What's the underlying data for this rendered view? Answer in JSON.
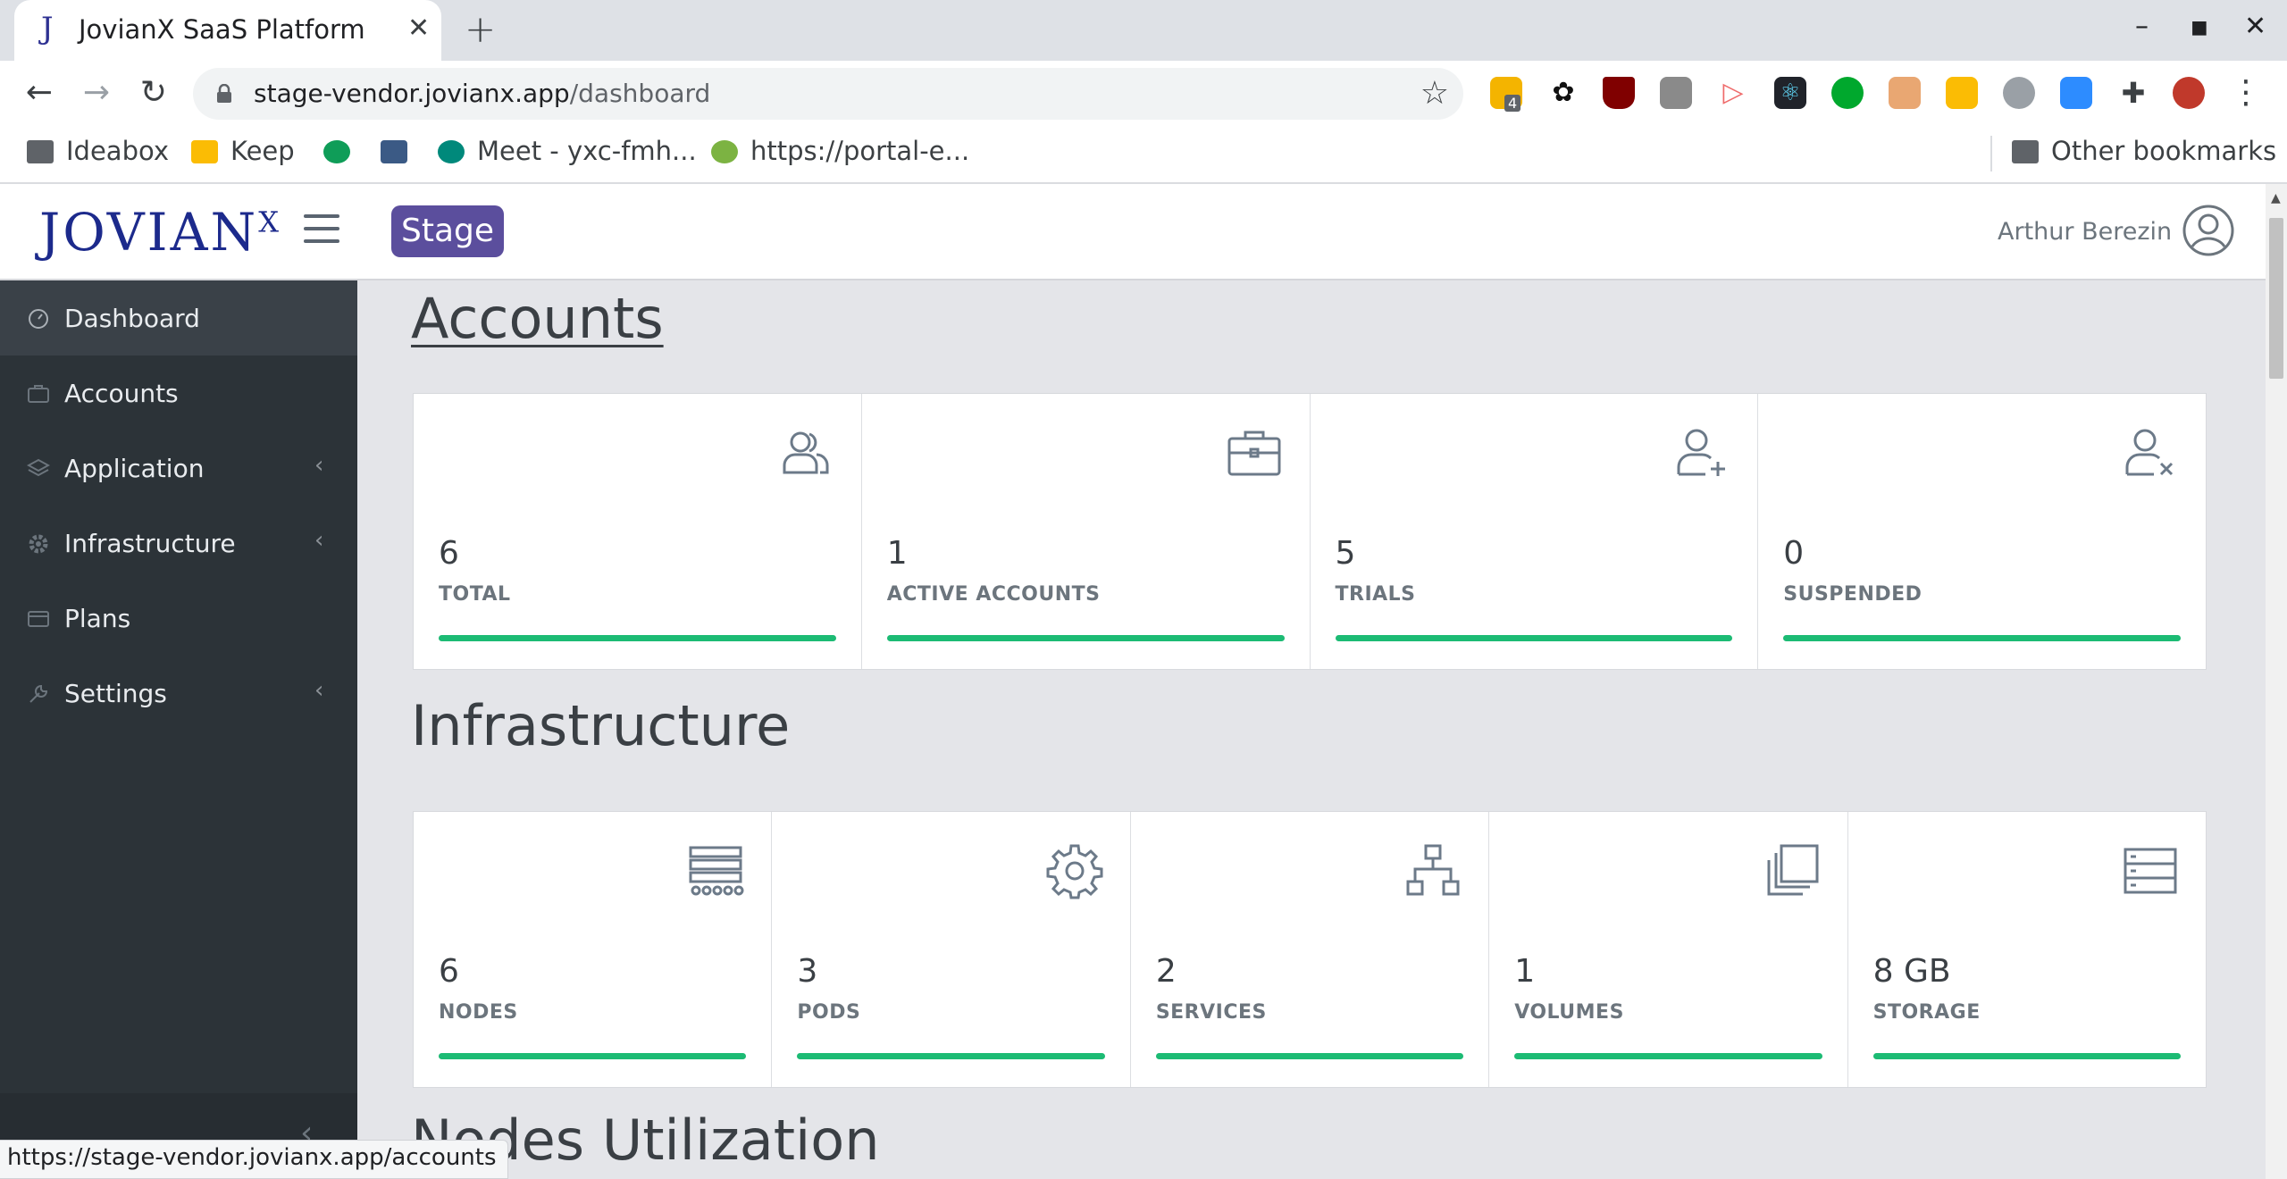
{
  "browser": {
    "tab_title": "JovianX SaaS Platform",
    "tab_favicon": "J",
    "url_host": "stage-vendor.jovianx.app",
    "url_path": "/dashboard",
    "extension_badge": "4",
    "bookmarks": [
      "Ideabox",
      "Keep",
      "Meet - yxc-fmh...",
      "https://portal-e...",
      "Other bookmarks"
    ],
    "status_url": "https://stage-vendor.jovianx.app/accounts"
  },
  "header": {
    "logo_text": "JOVIAN",
    "logo_sup": "X",
    "env_badge": "Stage",
    "user_name": "Arthur Berezin"
  },
  "sidebar": {
    "items": [
      {
        "label": "Dashboard",
        "icon": "speedometer-icon"
      },
      {
        "label": "Accounts",
        "icon": "briefcase-icon"
      },
      {
        "label": "Application",
        "icon": "layers-icon"
      },
      {
        "label": "Infrastructure",
        "icon": "gear-icon"
      },
      {
        "label": "Plans",
        "icon": "credit-card-icon"
      },
      {
        "label": "Settings",
        "icon": "wrench-icon"
      }
    ]
  },
  "accounts": {
    "title": "Accounts",
    "cards": [
      {
        "value": "6",
        "label": "TOTAL",
        "icon": "users-icon",
        "progress": 1.0
      },
      {
        "value": "1",
        "label": "ACTIVE ACCOUNTS",
        "icon": "briefcase-icon",
        "progress": 1.0
      },
      {
        "value": "5",
        "label": "TRIALS",
        "icon": "user-plus-icon",
        "progress": 1.0
      },
      {
        "value": "0",
        "label": "SUSPENDED",
        "icon": "user-x-icon",
        "progress": 1.0
      }
    ]
  },
  "infrastructure": {
    "title": "Infrastructure",
    "cards": [
      {
        "value": "6",
        "label": "NODES",
        "icon": "nodes-icon",
        "progress": 1.0
      },
      {
        "value": "3",
        "label": "PODS",
        "icon": "gear-icon",
        "progress": 1.0
      },
      {
        "value": "2",
        "label": "SERVICES",
        "icon": "sitemap-icon",
        "progress": 1.0
      },
      {
        "value": "1",
        "label": "VOLUMES",
        "icon": "layers-stack-icon",
        "progress": 1.0
      },
      {
        "value": "8 GB",
        "label": "STORAGE",
        "icon": "storage-icon",
        "progress": 1.0
      }
    ]
  },
  "nodes_utilization": {
    "title": "Nodes Utilization"
  },
  "colors": {
    "accent_green": "#1cbb74",
    "stage_badge": "#5b4e9d",
    "sidebar_bg": "#2c3338"
  }
}
